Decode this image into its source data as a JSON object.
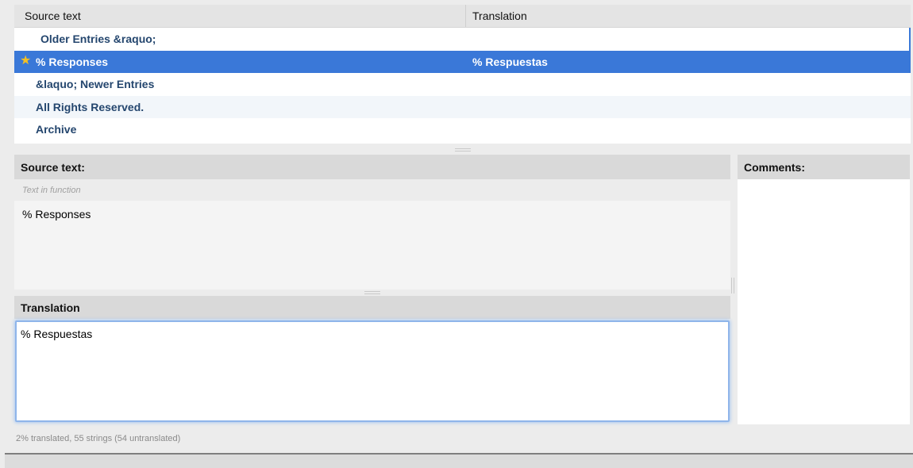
{
  "table": {
    "headers": {
      "source": "Source text",
      "translation": "Translation"
    },
    "rows": [
      {
        "source": "Older Entries &raquo;",
        "translation": ""
      },
      {
        "source": "% Responses",
        "translation": "% Respuestas"
      },
      {
        "source": "&laquo; Newer Entries",
        "translation": ""
      },
      {
        "source": "All Rights Reserved.",
        "translation": ""
      },
      {
        "source": "Archive",
        "translation": ""
      }
    ],
    "selected_index": 1,
    "selected_icon": "star-icon"
  },
  "source_panel": {
    "title": "Source text:",
    "hint": "Text in function",
    "text": "% Responses"
  },
  "translation_panel": {
    "title": "Translation",
    "text": "% Respuestas"
  },
  "comments_panel": {
    "title": "Comments:"
  },
  "status": {
    "text": "2% translated, 55 strings (54 untranslated)"
  },
  "colors": {
    "selection": "#3a78d8",
    "row_text": "#24466e",
    "star": "#f4c024"
  }
}
